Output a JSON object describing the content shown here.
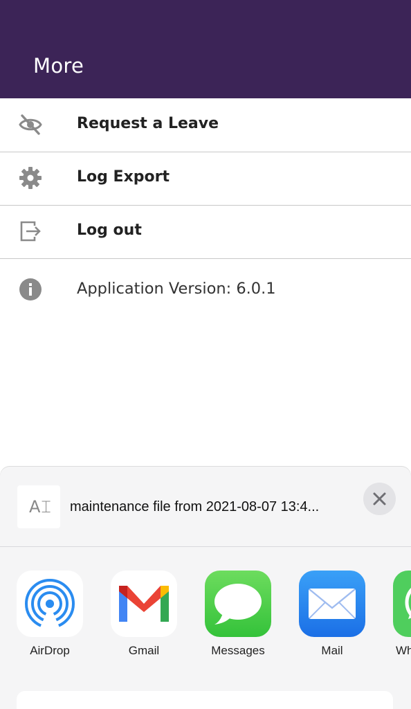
{
  "header": {
    "title": "More",
    "background": "#3c2457"
  },
  "menu": {
    "items": [
      {
        "label": "Request a Leave",
        "icon": "eye-off-icon"
      },
      {
        "label": "Log Export",
        "icon": "gear-icon"
      },
      {
        "label": "Log out",
        "icon": "logout-icon"
      },
      {
        "label": "Application Version: 6.0.1",
        "icon": "info-icon"
      }
    ]
  },
  "share_sheet": {
    "file_name": "maintenance file from 2021-08-07 13:4...",
    "file_thumb_text": "A⌶",
    "apps": [
      {
        "label": "AirDrop",
        "icon": "airdrop-icon"
      },
      {
        "label": "Gmail",
        "icon": "gmail-icon"
      },
      {
        "label": "Messages",
        "icon": "messages-icon"
      },
      {
        "label": "Mail",
        "icon": "mail-icon"
      },
      {
        "label": "Wh",
        "icon": "whatsapp-icon"
      }
    ]
  }
}
